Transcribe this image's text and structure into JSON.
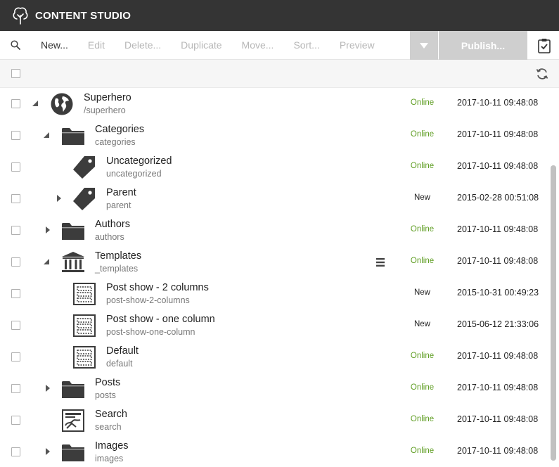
{
  "app": {
    "title": "CONTENT STUDIO"
  },
  "toolbar": {
    "new_label": "New...",
    "edit_label": "Edit",
    "delete_label": "Delete...",
    "duplicate_label": "Duplicate",
    "move_label": "Move...",
    "sort_label": "Sort...",
    "preview_label": "Preview",
    "publish_label": "Publish..."
  },
  "colors": {
    "header": "#343434",
    "online": "#609e24",
    "disabled": "#b7b7b7"
  },
  "rows": [
    {
      "name": "Superhero",
      "path": "/superhero",
      "icon": "globe-icon",
      "status": "Online",
      "modified": "2017-10-11 09:48:08",
      "toggle": "expanded"
    },
    {
      "name": "Categories",
      "path": "categories",
      "icon": "folder-icon",
      "status": "Online",
      "modified": "2017-10-11 09:48:08",
      "toggle": "expanded"
    },
    {
      "name": "Uncategorized",
      "path": "uncategorized",
      "icon": "tag-icon",
      "status": "Online",
      "modified": "2017-10-11 09:48:08",
      "toggle": "none"
    },
    {
      "name": "Parent",
      "path": "parent",
      "icon": "tag-icon",
      "status": "New",
      "modified": "2015-02-28 00:51:08",
      "toggle": "collapsed"
    },
    {
      "name": "Authors",
      "path": "authors",
      "icon": "folder-icon",
      "status": "Online",
      "modified": "2017-10-11 09:48:08",
      "toggle": "collapsed"
    },
    {
      "name": "Templates",
      "path": "_templates",
      "icon": "templates-icon",
      "status": "Online",
      "modified": "2017-10-11 09:48:08",
      "toggle": "expanded"
    },
    {
      "name": "Post show - 2 columns",
      "path": "post-show-2-columns",
      "icon": "page-template-icon",
      "status": "New",
      "modified": "2015-10-31 00:49:23",
      "toggle": "none"
    },
    {
      "name": "Post show - one column",
      "path": "post-show-one-column",
      "icon": "page-template-icon",
      "status": "New",
      "modified": "2015-06-12 21:33:06",
      "toggle": "none"
    },
    {
      "name": "Default",
      "path": "default",
      "icon": "page-template-icon",
      "status": "Online",
      "modified": "2017-10-11 09:48:08",
      "toggle": "none"
    },
    {
      "name": "Posts",
      "path": "posts",
      "icon": "folder-icon",
      "status": "Online",
      "modified": "2017-10-11 09:48:08",
      "toggle": "collapsed"
    },
    {
      "name": "Search",
      "path": "search",
      "icon": "search-page-icon",
      "status": "Online",
      "modified": "2017-10-11 09:48:08",
      "toggle": "none"
    },
    {
      "name": "Images",
      "path": "images",
      "icon": "folder-icon",
      "status": "Online",
      "modified": "2017-10-11 09:48:08",
      "toggle": "collapsed"
    }
  ]
}
